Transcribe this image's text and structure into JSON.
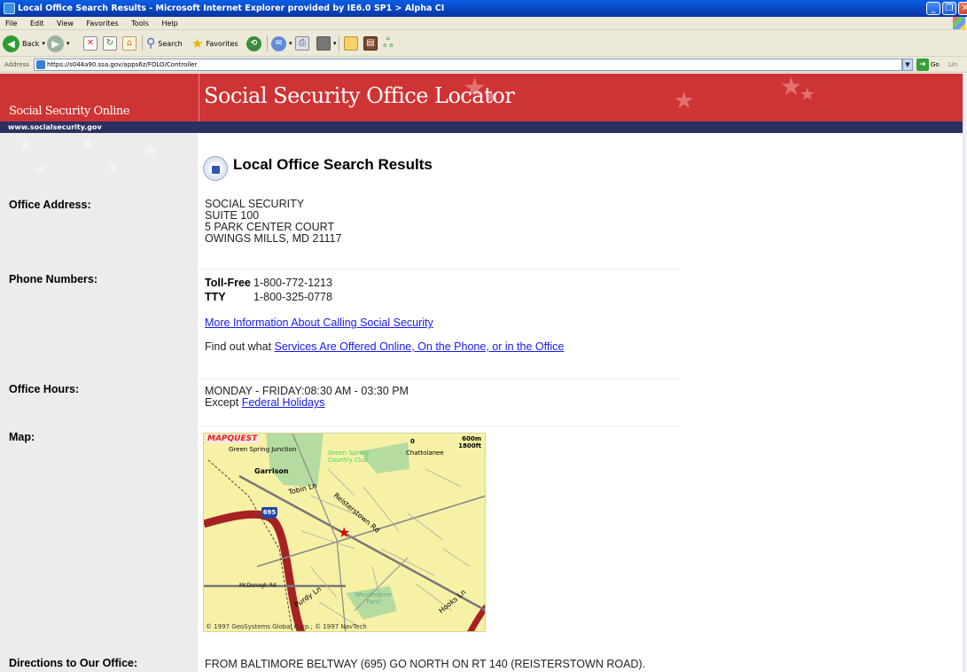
{
  "window": {
    "title": "Local Office Search Results - Microsoft Internet Explorer provided by IE6.0 SP1 > Alpha CI"
  },
  "menu": [
    "File",
    "Edit",
    "View",
    "Favorites",
    "Tools",
    "Help"
  ],
  "toolbar": {
    "back_label": "Back",
    "search_label": "Search",
    "favorites_label": "Favorites"
  },
  "address": {
    "label": "Address",
    "url": "https://s044a90.ssa.gov/apps6z/FOLO/Controller",
    "go_label": "Go",
    "links_label": "Lin"
  },
  "banner": {
    "site_name": "Social Security Online",
    "site_url": "www.socialsecurity.gov",
    "page_title": "Social Security Office Locator"
  },
  "heading": "Local Office Search Results",
  "address_section": {
    "label": "Office Address:",
    "lines": [
      "SOCIAL SECURITY",
      "SUITE 100",
      "5 PARK CENTER COURT",
      "OWINGS MILLS, MD 21117"
    ]
  },
  "phone_section": {
    "label": "Phone Numbers:",
    "tollfree_label": "Toll-Free",
    "tollfree_number": "1-800-772-1213",
    "tty_label": "TTY",
    "tty_number": "1-800-325-0778",
    "more_info_link": "More Information About Calling Social Security",
    "services_prefix": "Find out what ",
    "services_link": "Services Are Offered Online, On the Phone, or in the Office"
  },
  "hours_section": {
    "label": "Office Hours:",
    "hours": "MONDAY - FRIDAY:08:30 AM - 03:30 PM",
    "except_prefix": "Except ",
    "holidays_link": "Federal Holidays"
  },
  "map_section": {
    "label": "Map:",
    "logo": "MAPQUEST",
    "scale_zero": "0",
    "scale_metric": "600m",
    "scale_imperial": "1800ft",
    "labels": {
      "green_spring_junction": "Green Spring Junction",
      "green_spring_cc": "Green Spring Country Club",
      "chattolanee": "Chattolanee",
      "garrison": "Garrison",
      "tobin": "Tobin Ln",
      "reisterstown": "Reisterstown Rd",
      "mcdonogh": "McDonogh Rd",
      "purdy": "Purdy Ln",
      "woodholme": "Woodholme Park",
      "hooks": "Hooks Ln",
      "shield": "695"
    },
    "copyright": "© 1997 GeoSystems Global Corp.; © 1997 NavTech"
  },
  "directions_section": {
    "label": "Directions to Our Office:",
    "text": "FROM BALTIMORE BELTWAY (695) GO NORTH ON RT 140 (REISTERSTOWN ROAD)."
  }
}
